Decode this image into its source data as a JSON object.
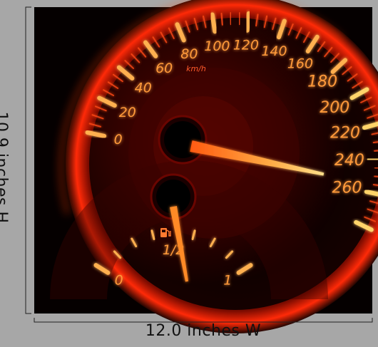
{
  "speed_scale": {
    "unit": "km/h",
    "labels": [
      "0",
      "20",
      "40",
      "60",
      "80",
      "100",
      "120",
      "140",
      "160",
      "180",
      "200",
      "220",
      "240",
      "260"
    ],
    "needle_value": 260
  },
  "fuel_scale": {
    "labels": [
      "0",
      "1/2",
      "1"
    ],
    "icon": "fuel-pump-icon",
    "needle_value": 0.55
  },
  "dimensions": {
    "width_label": "12.0 inches W",
    "height_label": "10.9 inches H"
  },
  "colors": {
    "background_frame": "#a7a7a7",
    "dial_background": "#050000",
    "glow": "#ff3a10",
    "numerals": "#ff9a3a",
    "needle": "#ff7a1e",
    "tick_hot": "#ffd46a"
  }
}
